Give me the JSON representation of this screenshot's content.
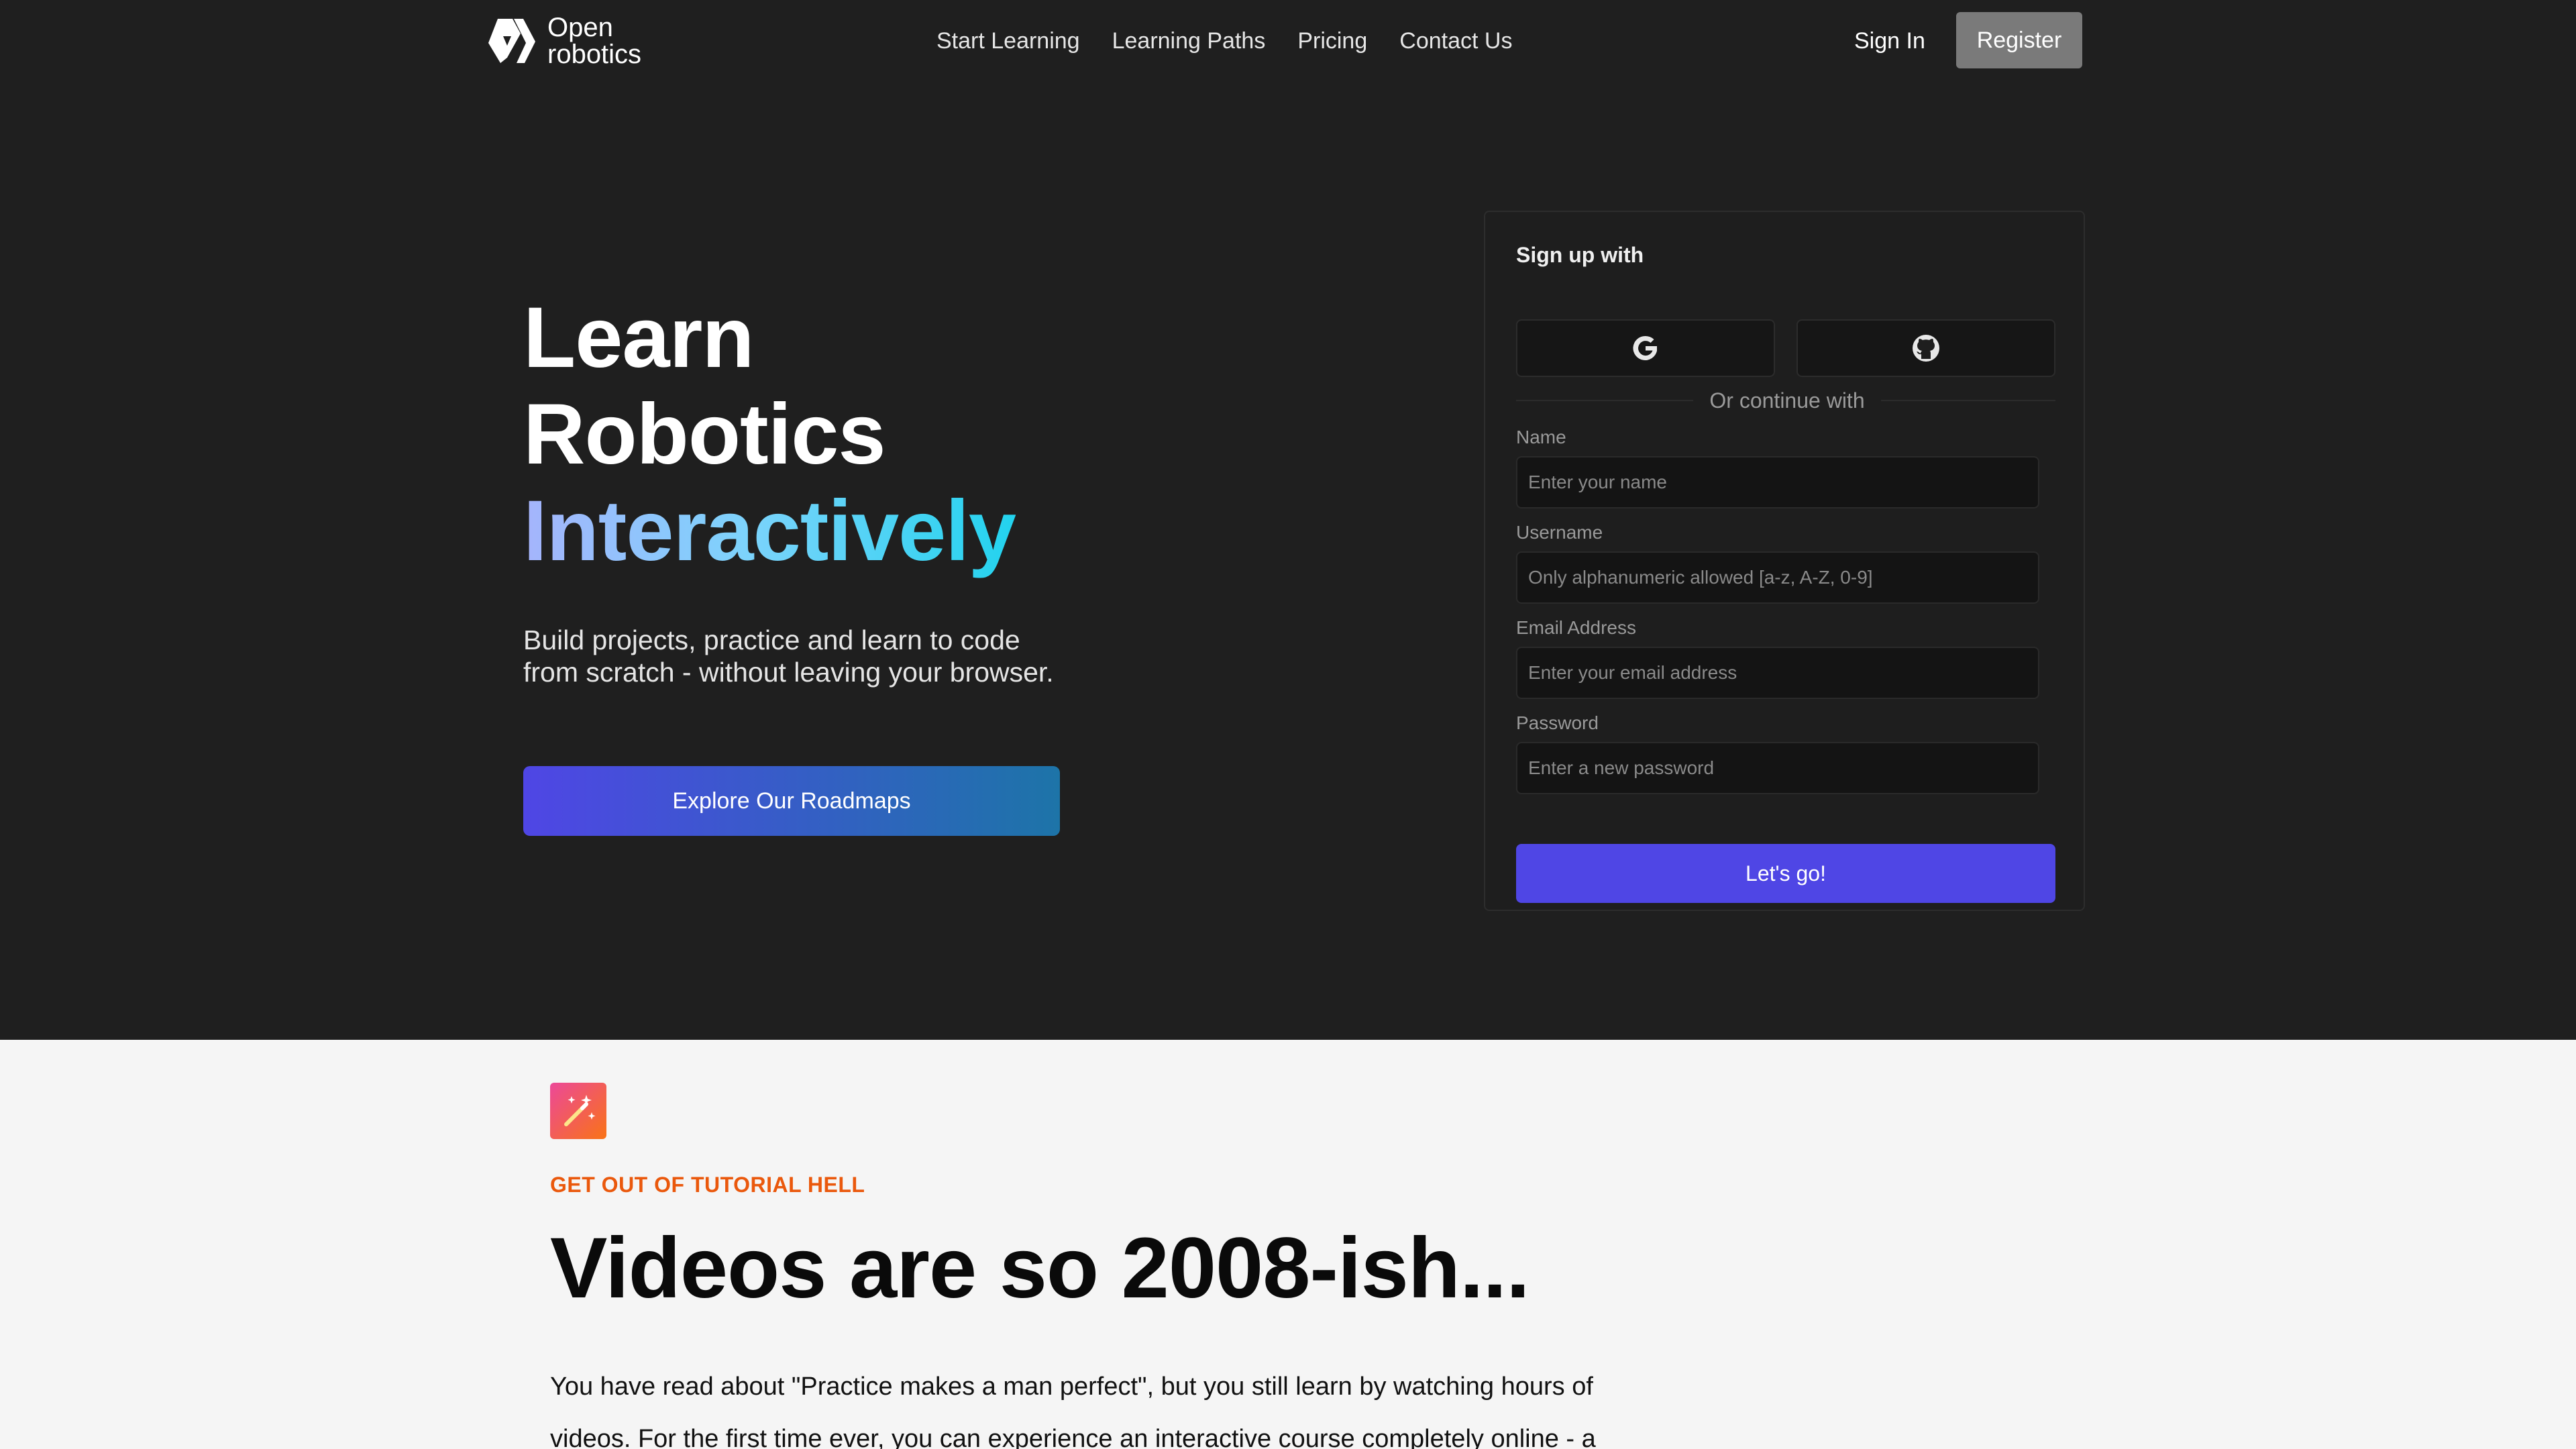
{
  "nav": {
    "logo_line1": "Open",
    "logo_line2": "robotics",
    "links": [
      "Start Learning",
      "Learning Paths",
      "Pricing",
      "Contact Us"
    ],
    "sign_in": "Sign In",
    "register": "Register"
  },
  "hero": {
    "headline_line1": "Learn",
    "headline_line2": "Robotics",
    "headline_line3": "Interactively",
    "subtitle": "Build projects, practice and learn to code from scratch - without leaving your browser.",
    "cta": "Explore Our Roadmaps"
  },
  "signup": {
    "title": "Sign up with",
    "oauth": [
      {
        "icon": "google-icon"
      },
      {
        "icon": "github-icon"
      }
    ],
    "divider": "Or continue with",
    "fields": {
      "name": {
        "label": "Name",
        "placeholder": "Enter your name"
      },
      "username": {
        "label": "Username",
        "placeholder": "Only alphanumeric allowed [a-z, A-Z, 0-9]"
      },
      "email": {
        "label": "Email Address",
        "placeholder": "Enter your email address"
      },
      "password": {
        "label": "Password",
        "placeholder": "Enter a new password"
      }
    },
    "submit": "Let's go!"
  },
  "feature": {
    "icon": "magic-wand-icon",
    "eyebrow": "GET OUT OF TUTORIAL HELL",
    "title": "Videos are so 2008-ish...",
    "body": "You have read about \"Practice makes a man perfect\", but you still learn by watching hours of videos. For the first time ever, you can experience an interactive course completely online - a"
  },
  "colors": {
    "dark_bg": "#1f1f1f",
    "accent": "#4f46e5",
    "eyebrow": "#ea580c",
    "register_bg": "#7a7a7a"
  }
}
